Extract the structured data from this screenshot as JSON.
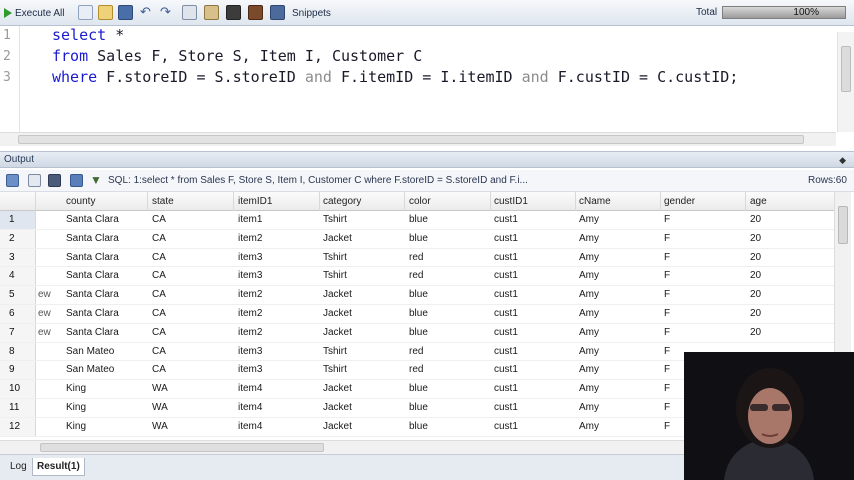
{
  "toolbar": {
    "execute_all_label": "Execute All",
    "snippets_label": "Snippets",
    "total_label": "Total",
    "progress_percent": 100,
    "progress_text": "100%",
    "icons": [
      "new-file-icon",
      "open-folder-icon",
      "save-icon",
      "undo-icon",
      "redo-icon",
      "copy-icon",
      "paste-icon",
      "highlight-icon",
      "chart-icon",
      "format-icon"
    ]
  },
  "editor": {
    "line_numbers": [
      "1",
      "2",
      "3"
    ],
    "lines": [
      [
        {
          "t": "select",
          "k": "kw"
        },
        {
          "t": " *",
          "k": ""
        }
      ],
      [
        {
          "t": "from",
          "k": "kw"
        },
        {
          "t": " Sales F, Store S, Item I, Customer C",
          "k": ""
        }
      ],
      [
        {
          "t": "where",
          "k": "kw"
        },
        {
          "t": " F.storeID = S.storeID ",
          "k": ""
        },
        {
          "t": "and",
          "k": "op"
        },
        {
          "t": " F.itemID = I.itemID ",
          "k": ""
        },
        {
          "t": "and",
          "k": "op"
        },
        {
          "t": " F.custID = C.custID;",
          "k": ""
        }
      ]
    ]
  },
  "output": {
    "title": "Output",
    "pin_glyph": "◆",
    "sql_summary": "SQL: 1:select *  from Sales F, Store S, Item I, Customer C  where F.storeID = S.storeID and F.i...",
    "rows_label": "Rows:60"
  },
  "grid": {
    "columns": [
      "county",
      "state",
      "itemID1",
      "category",
      "color",
      "custID1",
      "cName",
      "gender",
      "age"
    ],
    "rows": [
      {
        "num": "1",
        "current": true,
        "ghost": "",
        "cells": [
          "Santa Clara",
          "CA",
          "item1",
          "Tshirt",
          "blue",
          "cust1",
          "Amy",
          "F",
          "20"
        ]
      },
      {
        "num": "2",
        "current": false,
        "ghost": "",
        "cells": [
          "Santa Clara",
          "CA",
          "item2",
          "Jacket",
          "blue",
          "cust1",
          "Amy",
          "F",
          "20"
        ]
      },
      {
        "num": "3",
        "current": false,
        "ghost": "",
        "cells": [
          "Santa Clara",
          "CA",
          "item3",
          "Tshirt",
          "red",
          "cust1",
          "Amy",
          "F",
          "20"
        ]
      },
      {
        "num": "4",
        "current": false,
        "ghost": "",
        "cells": [
          "Santa Clara",
          "CA",
          "item3",
          "Tshirt",
          "red",
          "cust1",
          "Amy",
          "F",
          "20"
        ]
      },
      {
        "num": "5",
        "current": false,
        "ghost": "ew",
        "cells": [
          "Santa Clara",
          "CA",
          "item2",
          "Jacket",
          "blue",
          "cust1",
          "Amy",
          "F",
          "20"
        ]
      },
      {
        "num": "6",
        "current": false,
        "ghost": "ew",
        "cells": [
          "Santa Clara",
          "CA",
          "item2",
          "Jacket",
          "blue",
          "cust1",
          "Amy",
          "F",
          "20"
        ]
      },
      {
        "num": "7",
        "current": false,
        "ghost": "ew",
        "cells": [
          "Santa Clara",
          "CA",
          "item2",
          "Jacket",
          "blue",
          "cust1",
          "Amy",
          "F",
          "20"
        ]
      },
      {
        "num": "8",
        "current": false,
        "ghost": "",
        "cells": [
          "San Mateo",
          "CA",
          "item3",
          "Tshirt",
          "red",
          "cust1",
          "Amy",
          "F",
          ""
        ]
      },
      {
        "num": "9",
        "current": false,
        "ghost": "",
        "cells": [
          "San Mateo",
          "CA",
          "item3",
          "Tshirt",
          "red",
          "cust1",
          "Amy",
          "F",
          ""
        ]
      },
      {
        "num": "10",
        "current": false,
        "ghost": "",
        "cells": [
          "King",
          "WA",
          "item4",
          "Jacket",
          "blue",
          "cust1",
          "Amy",
          "F",
          ""
        ]
      },
      {
        "num": "11",
        "current": false,
        "ghost": "",
        "cells": [
          "King",
          "WA",
          "item4",
          "Jacket",
          "blue",
          "cust1",
          "Amy",
          "F",
          ""
        ]
      },
      {
        "num": "12",
        "current": false,
        "ghost": "",
        "cells": [
          "King",
          "WA",
          "item4",
          "Jacket",
          "blue",
          "cust1",
          "Amy",
          "F",
          ""
        ]
      }
    ]
  },
  "bottom_tabs": [
    {
      "label": "Log",
      "active": false
    },
    {
      "label": "Result(1)",
      "active": true
    }
  ]
}
